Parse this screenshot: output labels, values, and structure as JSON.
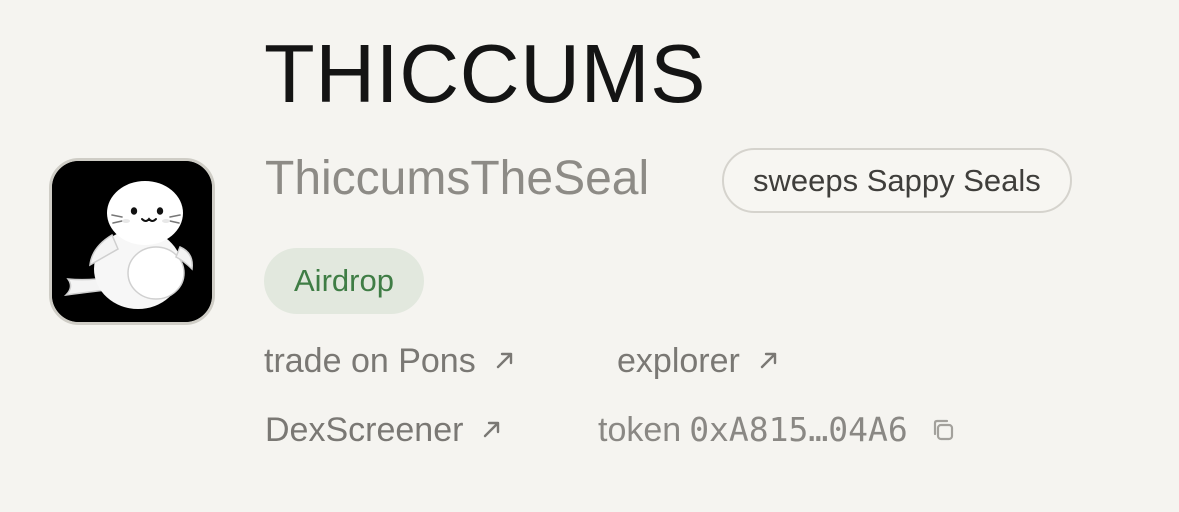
{
  "token": {
    "ticker": "THICCUMS",
    "name": "ThiccumsTheSeal",
    "avatar_icon": "seal-mascot"
  },
  "activity_tag": "sweeps Sappy Seals",
  "badge": {
    "label": "Airdrop",
    "bg_color": "#e2e8de",
    "text_color": "#3f7d45"
  },
  "links": {
    "trade": {
      "label": "trade on Pons",
      "icon": "external-link-arrow-icon"
    },
    "explorer": {
      "label": "explorer",
      "icon": "external-link-arrow-icon"
    },
    "dexscreener": {
      "label": "DexScreener",
      "icon": "external-link-arrow-icon"
    }
  },
  "contract": {
    "label": "token",
    "address_short": "0xA815…04A6",
    "icon": "copy-icon"
  },
  "colors": {
    "background": "#f5f4f0",
    "title": "#141414",
    "muted": "#8d8b86"
  }
}
